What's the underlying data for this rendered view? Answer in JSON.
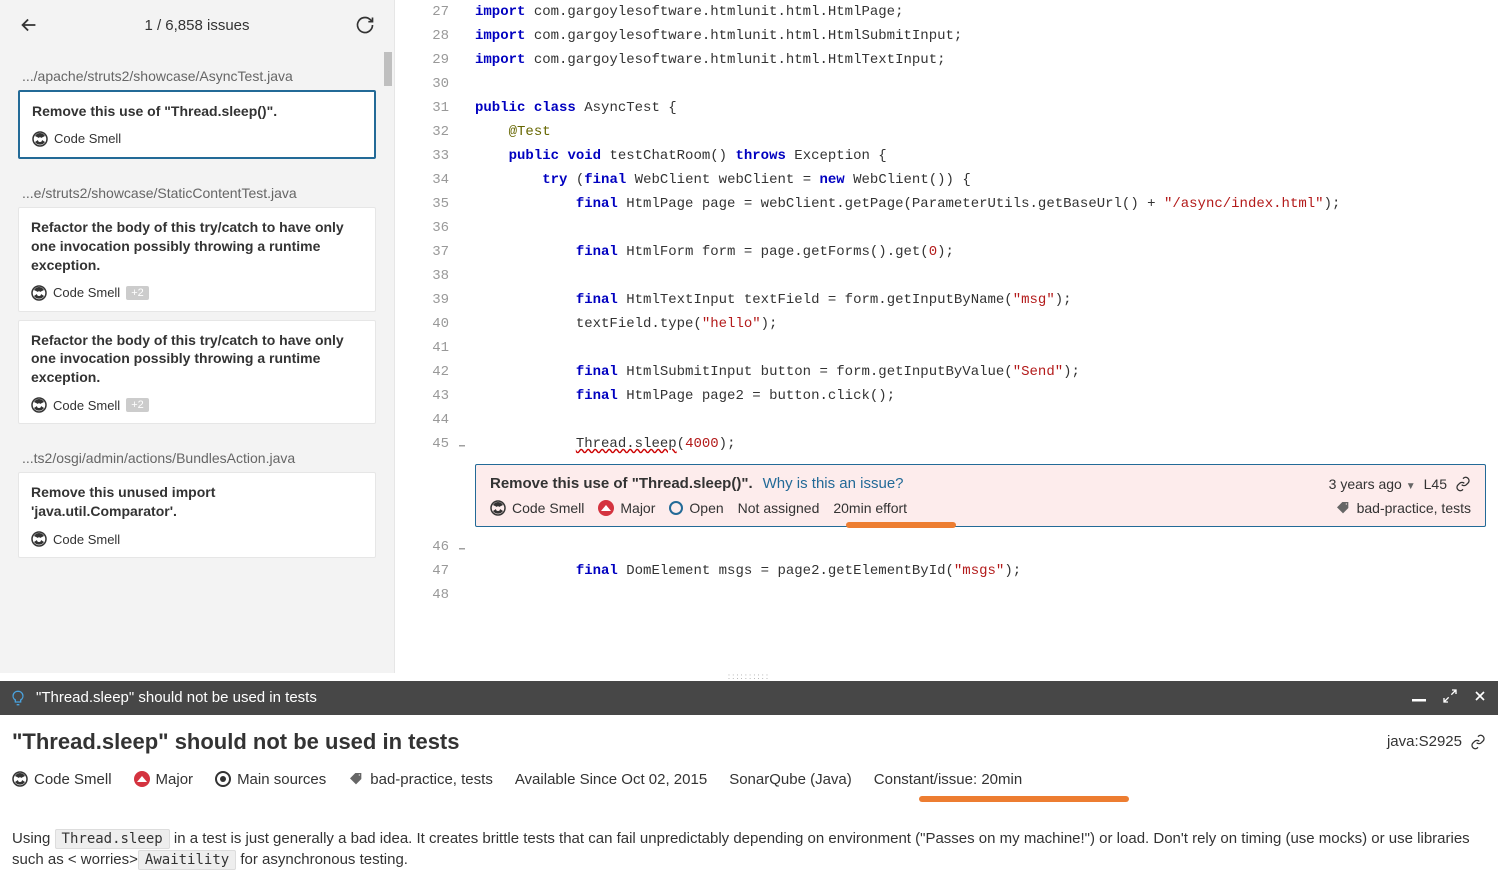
{
  "sidebar": {
    "counter": "1 / 6,858 issues",
    "groups": [
      {
        "path": ".../apache/struts2/showcase/AsyncTest.java",
        "issues": [
          {
            "title": "Remove this use of \"Thread.sleep()\".",
            "type": "Code Smell",
            "extra": null,
            "selected": true
          }
        ]
      },
      {
        "path": "...e/struts2/showcase/StaticContentTest.java",
        "issues": [
          {
            "title": "Refactor the body of this try/catch to have only one invocation possibly throwing a runtime exception.",
            "type": "Code Smell",
            "extra": "+2",
            "selected": false
          },
          {
            "title": "Refactor the body of this try/catch to have only one invocation possibly throwing a runtime exception.",
            "type": "Code Smell",
            "extra": "+2",
            "selected": false
          }
        ]
      },
      {
        "path": "...ts2/osgi/admin/actions/BundlesAction.java",
        "issues": [
          {
            "title": "Remove this unused import 'java.util.Comparator'.",
            "type": "Code Smell",
            "extra": null,
            "selected": false
          }
        ]
      }
    ]
  },
  "code": {
    "lines": [
      {
        "n": 27,
        "html": "<span class='kw'>import</span> com.gargoylesoftware.htmlunit.html.HtmlPage;"
      },
      {
        "n": 28,
        "html": "<span class='kw'>import</span> com.gargoylesoftware.htmlunit.html.HtmlSubmitInput;"
      },
      {
        "n": 29,
        "html": "<span class='kw'>import</span> com.gargoylesoftware.htmlunit.html.HtmlTextInput;"
      },
      {
        "n": 30,
        "html": ""
      },
      {
        "n": 31,
        "html": "<span class='kw'>public</span> <span class='kw'>class</span> AsyncTest {"
      },
      {
        "n": 32,
        "html": "    <span class='ann'>@Test</span>"
      },
      {
        "n": 33,
        "html": "    <span class='kw'>public</span> <span class='kw'>void</span> testChatRoom() <span class='kw'>throws</span> Exception {"
      },
      {
        "n": 34,
        "html": "        <span class='kw'>try</span> (<span class='kw'>final</span> WebClient webClient = <span class='kw'>new</span> WebClient()) {"
      },
      {
        "n": 35,
        "html": "            <span class='kw'>final</span> HtmlPage page = webClient.getPage(ParameterUtils.getBaseUrl() + <span class='str'>\"/async/index.html\"</span>);"
      },
      {
        "n": 36,
        "html": ""
      },
      {
        "n": 37,
        "html": "            <span class='kw'>final</span> HtmlForm form = page.getForms().get(<span class='num'>0</span>);"
      },
      {
        "n": 38,
        "html": ""
      },
      {
        "n": 39,
        "html": "            <span class='kw'>final</span> HtmlTextInput textField = form.getInputByName(<span class='str'>\"msg\"</span>);"
      },
      {
        "n": 40,
        "html": "            textField.type(<span class='str'>\"hello\"</span>);"
      },
      {
        "n": 41,
        "html": ""
      },
      {
        "n": 42,
        "html": "            <span class='kw'>final</span> HtmlSubmitInput button = form.getInputByValue(<span class='str'>\"Send\"</span>);"
      },
      {
        "n": 43,
        "html": "            <span class='kw'>final</span> HtmlPage page2 = button.click();"
      },
      {
        "n": 44,
        "html": ""
      },
      {
        "n": 45,
        "html": "            <span class='sqg'>Thread.sleep</span>(<span class='num'>4000</span>);",
        "fold": true
      }
    ],
    "after": [
      {
        "n": 46,
        "html": "",
        "fold": true
      },
      {
        "n": 47,
        "html": "            <span class='kw'>final</span> DomElement msgs = page2.getElementById(<span class='str'>\"msgs\"</span>);"
      },
      {
        "n": 48,
        "html": ""
      }
    ]
  },
  "inline": {
    "title": "Remove this use of \"Thread.sleep()\".",
    "why": "Why is this an issue?",
    "type": "Code Smell",
    "severity": "Major",
    "status": "Open",
    "assignee": "Not assigned",
    "effort": "20min effort",
    "age": "3 years ago",
    "line": "L45",
    "tags": "bad-practice, tests"
  },
  "ruleBar": {
    "title": "\"Thread.sleep\" should not be used in tests"
  },
  "rule": {
    "title": "\"Thread.sleep\" should not be used in tests",
    "id": "java:S2925",
    "type": "Code Smell",
    "severity": "Major",
    "scope": "Main sources",
    "tags": "bad-practice, tests",
    "since": "Available Since Oct 02, 2015",
    "engine": "SonarQube (Java)",
    "constant": "Constant/issue: 20min",
    "desc_pre": "Using ",
    "desc_chip1": "Thread.sleep",
    "desc_mid": " in a test is just generally a bad idea. It creates brittle tests that can fail unpredictably depending on environment (\"Passes on my machine!\") or load. Don't rely on timing (use mocks) or use libraries such as ",
    "desc_chip2": "Awaitility",
    "desc_post": " for asynchronous testing."
  }
}
